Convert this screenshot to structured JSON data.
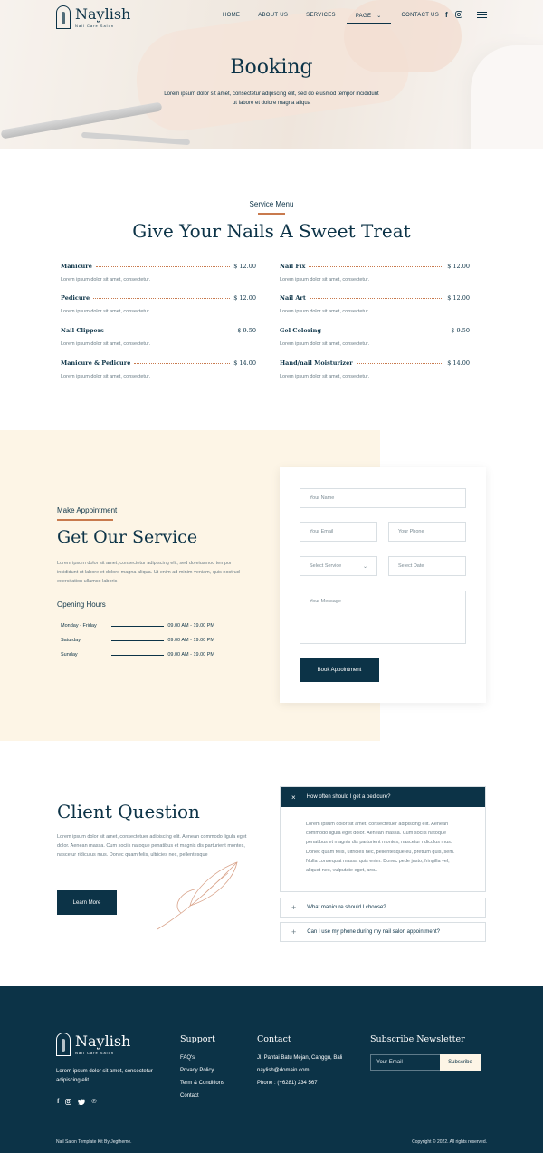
{
  "header": {
    "brand": "Naylish",
    "tagline": "Nail Care Salon",
    "nav": [
      {
        "label": "HOME"
      },
      {
        "label": "ABOUT US"
      },
      {
        "label": "SERVICES"
      },
      {
        "label": "PAGE"
      },
      {
        "label": "CONTACT US"
      }
    ],
    "social": [
      "facebook-icon",
      "instagram-icon"
    ],
    "menu_icon": "hamburger-menu-icon"
  },
  "hero": {
    "title": "Booking",
    "text": "Lorem ipsum dolor sit amet, consectetur adipiscing elit, sed do eiusmod tempor incididunt ut labore et dolore magna aliqua"
  },
  "services": {
    "eyebrow": "Service Menu",
    "title": "Give Your Nails A Sweet Treat",
    "items": [
      {
        "name": "Manicure",
        "price": "$ 12.00",
        "desc": "Lorem ipsum dolor sit amet, consectetur."
      },
      {
        "name": "Nail Fix",
        "price": "$ 12.00",
        "desc": "Lorem ipsum dolor sit amet, consectetur."
      },
      {
        "name": "Pedicure",
        "price": "$ 12.00",
        "desc": "Lorem ipsum dolor sit amet, consectetur."
      },
      {
        "name": "Nail Art",
        "price": "$ 12.00",
        "desc": "Lorem ipsum dolor sit amet, consectetur."
      },
      {
        "name": "Nail Clippers",
        "price": "$ 9.50",
        "desc": "Lorem ipsum dolor sit amet, consectetur."
      },
      {
        "name": "Gel Coloring",
        "price": "$ 9.50",
        "desc": "Lorem ipsum dolor sit amet, consectetur."
      },
      {
        "name": "Manicure & Pedicure",
        "price": "$ 14.00",
        "desc": "Lorem ipsum dolor sit amet, consectetur."
      },
      {
        "name": "Hand/nail Moisturizer",
        "price": "$ 14.00",
        "desc": "Lorem ipsum dolor sit amet, consectetur."
      }
    ]
  },
  "appointment": {
    "eyebrow": "Make Appointment",
    "title": "Get Our Service",
    "text": "Lorem ipsum dolor sit amet, consectetur adipiscing elit, sed do eiusmod tempor incididunt ut labore et dolore magna aliqua. Ut enim ad minim veniam, quis nostrud exercitation ullamco laboris",
    "hours_title": "Opening Hours",
    "hours": [
      {
        "day": "Monday - Friday",
        "time": "09.00 AM - 19.00 PM"
      },
      {
        "day": "Saturday",
        "time": "09.00 AM - 19.00 PM"
      },
      {
        "day": "Sunday",
        "time": "09.00 AM - 19.00 PM"
      }
    ],
    "form": {
      "name_placeholder": "Your Name",
      "email_placeholder": "Your Email",
      "phone_placeholder": "Your Phone",
      "service_placeholder": "Select Service",
      "date_placeholder": "Select Date",
      "message_placeholder": "Your Message",
      "submit_label": "Book Appointment"
    }
  },
  "faq": {
    "title": "Client Question",
    "text": "Lorem ipsum dolor sit amet, consectetuer adipiscing elit. Aenean commodo ligula eget dolor. Aenean massa. Cum sociis natoque penatibus et magnis dis parturient montes, nascetur ridiculus mus. Donec quam felis, ultricies nec, pellentesque",
    "button_label": "Learn More",
    "items": [
      {
        "question": "How often should I get a pedicure?",
        "answer": "Lorem ipsum dolor sit amet, consectetuer adipiscing elit. Aenean commodo ligula eget dolor. Aenean massa. Cum sociis natoque penatibus et magnis dis parturient montes, nascetur ridiculus mus. Donec quam felis, ultricies nec, pellentesque eu, pretium quis, sem. Nulla consequat massa quis enim. Donec pede justo, fringilla vel, aliquet nec, vulputate eget, arcu.",
        "open": true
      },
      {
        "question": "What manicure should I choose?",
        "open": false
      },
      {
        "question": "Can I use my phone during my nail salon appointment?",
        "open": false
      }
    ]
  },
  "footer": {
    "brand": "Naylish",
    "tagline": "Nail Care Salon",
    "about": "Lorem ipsum dolor sit amet, consectetur adipiscing elit.",
    "social": [
      "facebook-icon",
      "instagram-icon",
      "twitter-icon",
      "pinterest-icon"
    ],
    "support_title": "Support",
    "support_links": [
      "FAQ's",
      "Privacy Policy",
      "Term & Conditions",
      "Contact"
    ],
    "contact_title": "Contact",
    "contact_lines": [
      "Jl. Pantai Batu Mejan, Canggu, Bali",
      "naylish@domain.com",
      "Phone : (+6281) 234 567"
    ],
    "newsletter_title": "Subscribe Newsletter",
    "newsletter_placeholder": "Your Email",
    "newsletter_button": "Subscribe",
    "credit": "Nail Salon Template Kit By Jegtheme.",
    "copyright": "Copyright © 2022. All rights reserved."
  },
  "colors": {
    "primary": "#0c3347",
    "accent": "#c87a4e",
    "cream": "#fdf5e6"
  }
}
